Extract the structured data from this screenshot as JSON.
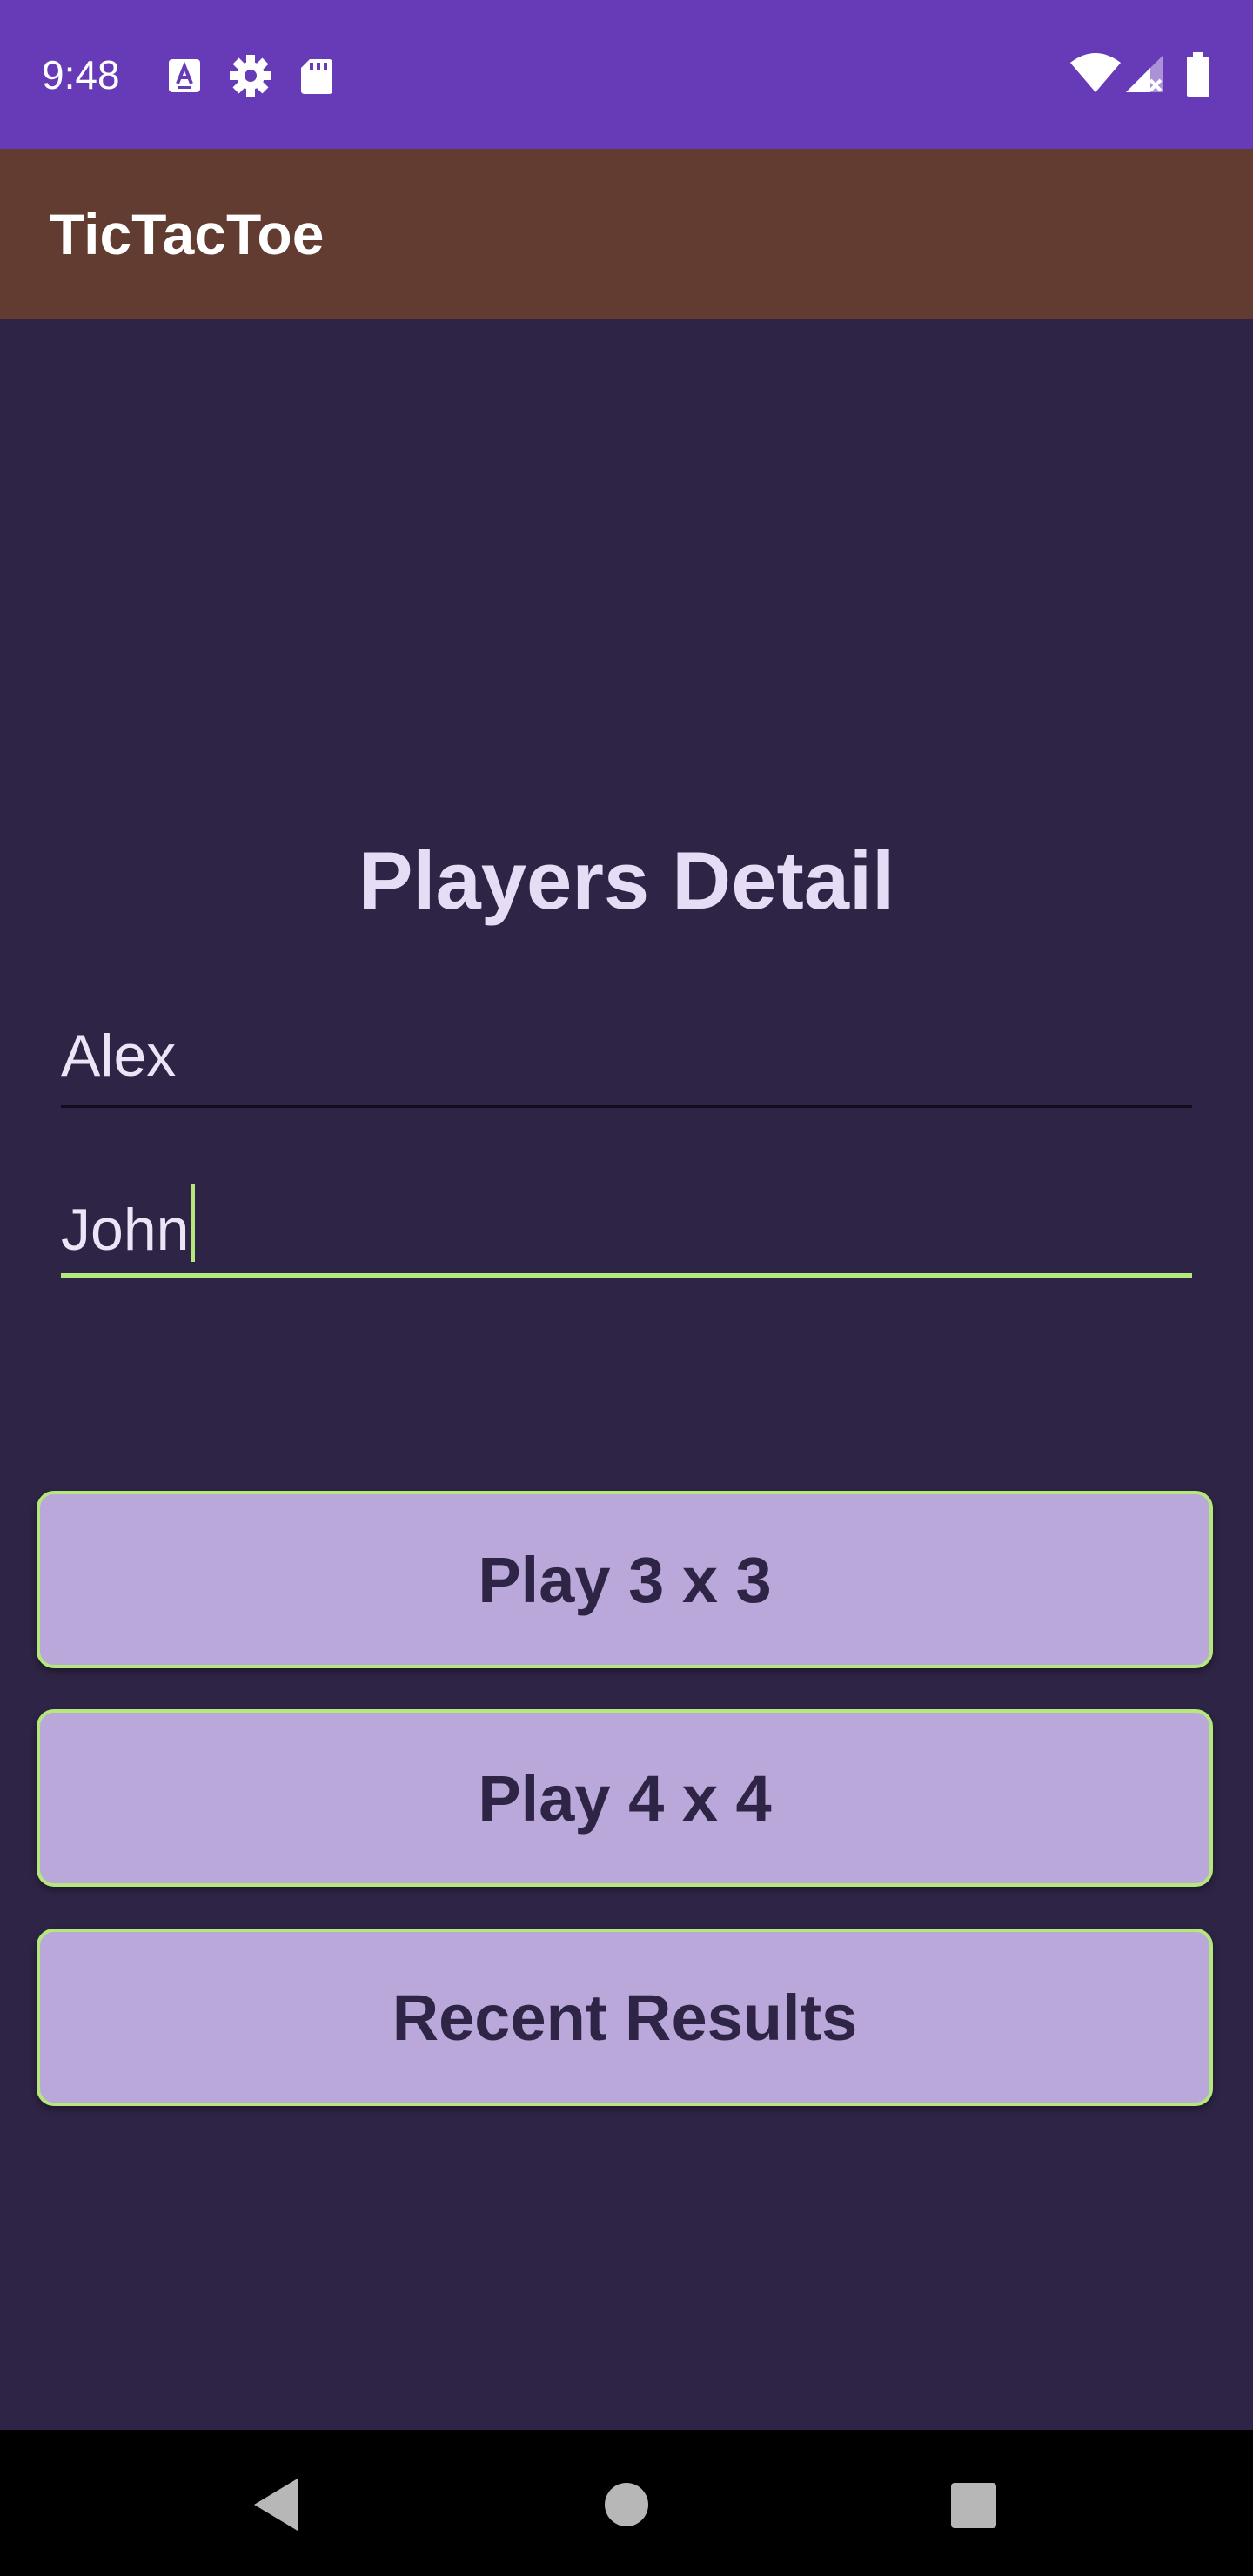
{
  "status_bar": {
    "time": "9:48",
    "left_icons": [
      "keyboard-a-icon",
      "gear-icon",
      "sd-card-icon"
    ],
    "right_icons": [
      "wifi-icon",
      "cell-signal-icon",
      "battery-icon"
    ],
    "background": "#673ab7"
  },
  "app_bar": {
    "title": "TicTacToe",
    "background": "#623c30"
  },
  "main": {
    "heading": "Players Detail",
    "player1": {
      "value": "Alex"
    },
    "player2": {
      "value": "John"
    },
    "buttons": [
      {
        "label": "Play 3 x 3"
      },
      {
        "label": "Play 4 x 4"
      },
      {
        "label": "Recent Results"
      }
    ],
    "accent": "#b5e87c",
    "button_fill": "#b9a8d9",
    "background": "#2e2445"
  },
  "nav_bar": {
    "icons": [
      "back-icon",
      "home-icon",
      "recents-icon"
    ]
  }
}
